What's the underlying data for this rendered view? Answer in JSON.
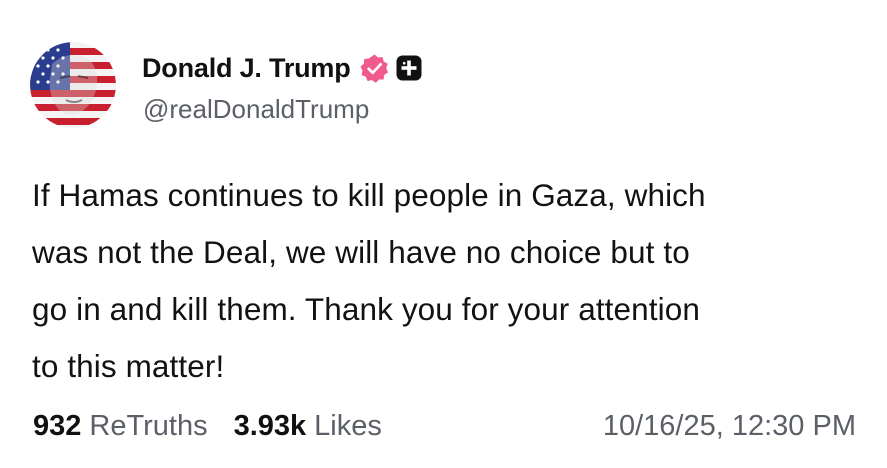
{
  "author": {
    "display_name": "Donald J. Trump",
    "handle": "@realDonaldTrump",
    "verified_badge_icon": "verified-badge-icon",
    "affiliation_icon": "plus-square-icon",
    "avatar_icon": "american-flag-portrait-avatar"
  },
  "post": {
    "text_lines": [
      "If Hamas continues to kill people in Gaza, which",
      "was not the Deal, we will have no choice but to",
      "go in and kill them. Thank you for your attention",
      "to this matter!"
    ]
  },
  "stats": {
    "retruths_count": "932",
    "retruths_label": "ReTruths",
    "likes_count": "3.93k",
    "likes_label": "Likes",
    "timestamp": "10/16/25, 12:30 PM"
  },
  "colors": {
    "verified_badge": "#f05a8c",
    "text_primary": "#111111",
    "text_secondary": "#5b5f66",
    "background": "#ffffff"
  }
}
